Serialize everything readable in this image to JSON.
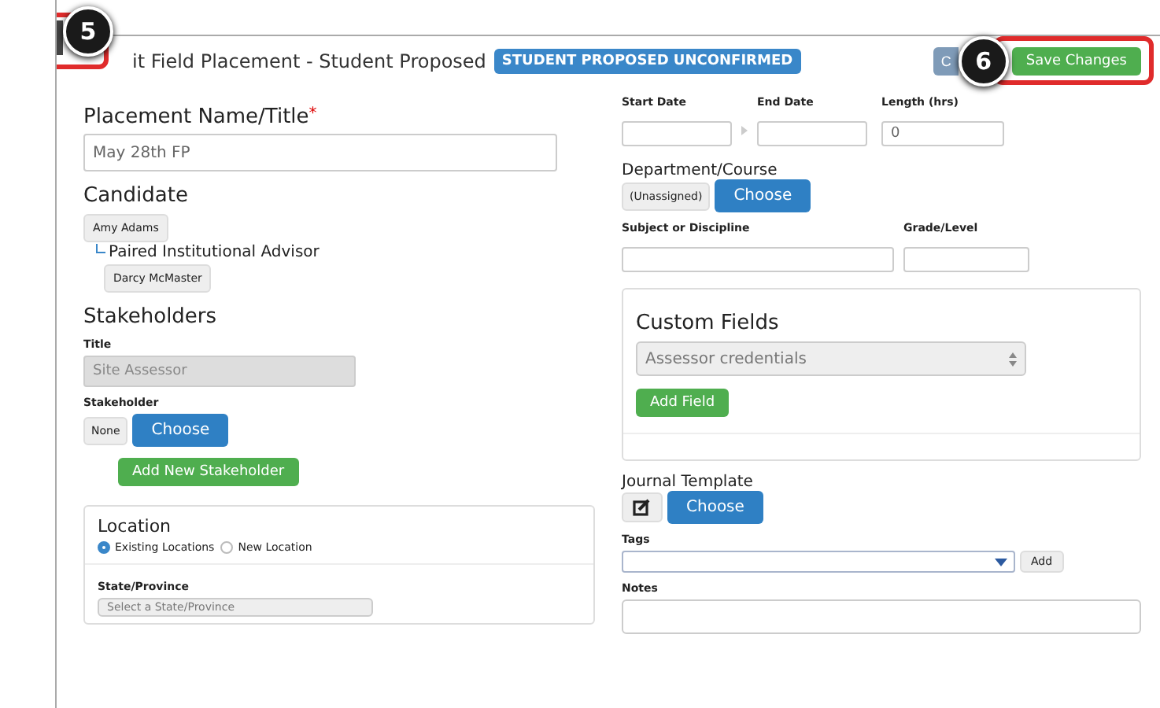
{
  "header": {
    "title": "it Field Placement - Student Proposed",
    "status_badge": "STUDENT PROPOSED UNCONFIRMED",
    "cancel_button": "C",
    "save_button": "Save Changes"
  },
  "callouts": [
    "5",
    "6"
  ],
  "left": {
    "placement_label": "Placement Name/Title",
    "required_mark": "*",
    "placement_value": "May 28th FP",
    "candidate_heading": "Candidate",
    "candidate": "Amy Adams",
    "advisor_heading": "Paired Institutional Advisor",
    "advisor": "Darcy McMaster",
    "stakeholders_heading": "Stakeholders",
    "title_label": "Title",
    "title_value": "Site Assessor",
    "stakeholder_label": "Stakeholder",
    "stakeholder_value": "None",
    "choose_button": "Choose",
    "add_stakeholder_button": "Add New Stakeholder",
    "location": {
      "heading": "Location",
      "options": [
        {
          "label": "Existing Locations",
          "selected": true
        },
        {
          "label": "New Location",
          "selected": false
        }
      ],
      "state_label": "State/Province",
      "state_placeholder": "Select a State/Province"
    }
  },
  "right": {
    "start_label": "Start Date",
    "end_label": "End Date",
    "length_label": "Length (hrs)",
    "length_value": "0",
    "department_heading": "Department/Course",
    "department_value": "(Unassigned)",
    "department_choose": "Choose",
    "subject_label": "Subject or Discipline",
    "grade_label": "Grade/Level",
    "custom_fields": {
      "heading": "Custom Fields",
      "select_value": "Assessor credentials",
      "add_button": "Add Field"
    },
    "journal_heading": "Journal Template",
    "journal_choose": "Choose",
    "tags_label": "Tags",
    "tags_add": "Add",
    "notes_label": "Notes"
  }
}
